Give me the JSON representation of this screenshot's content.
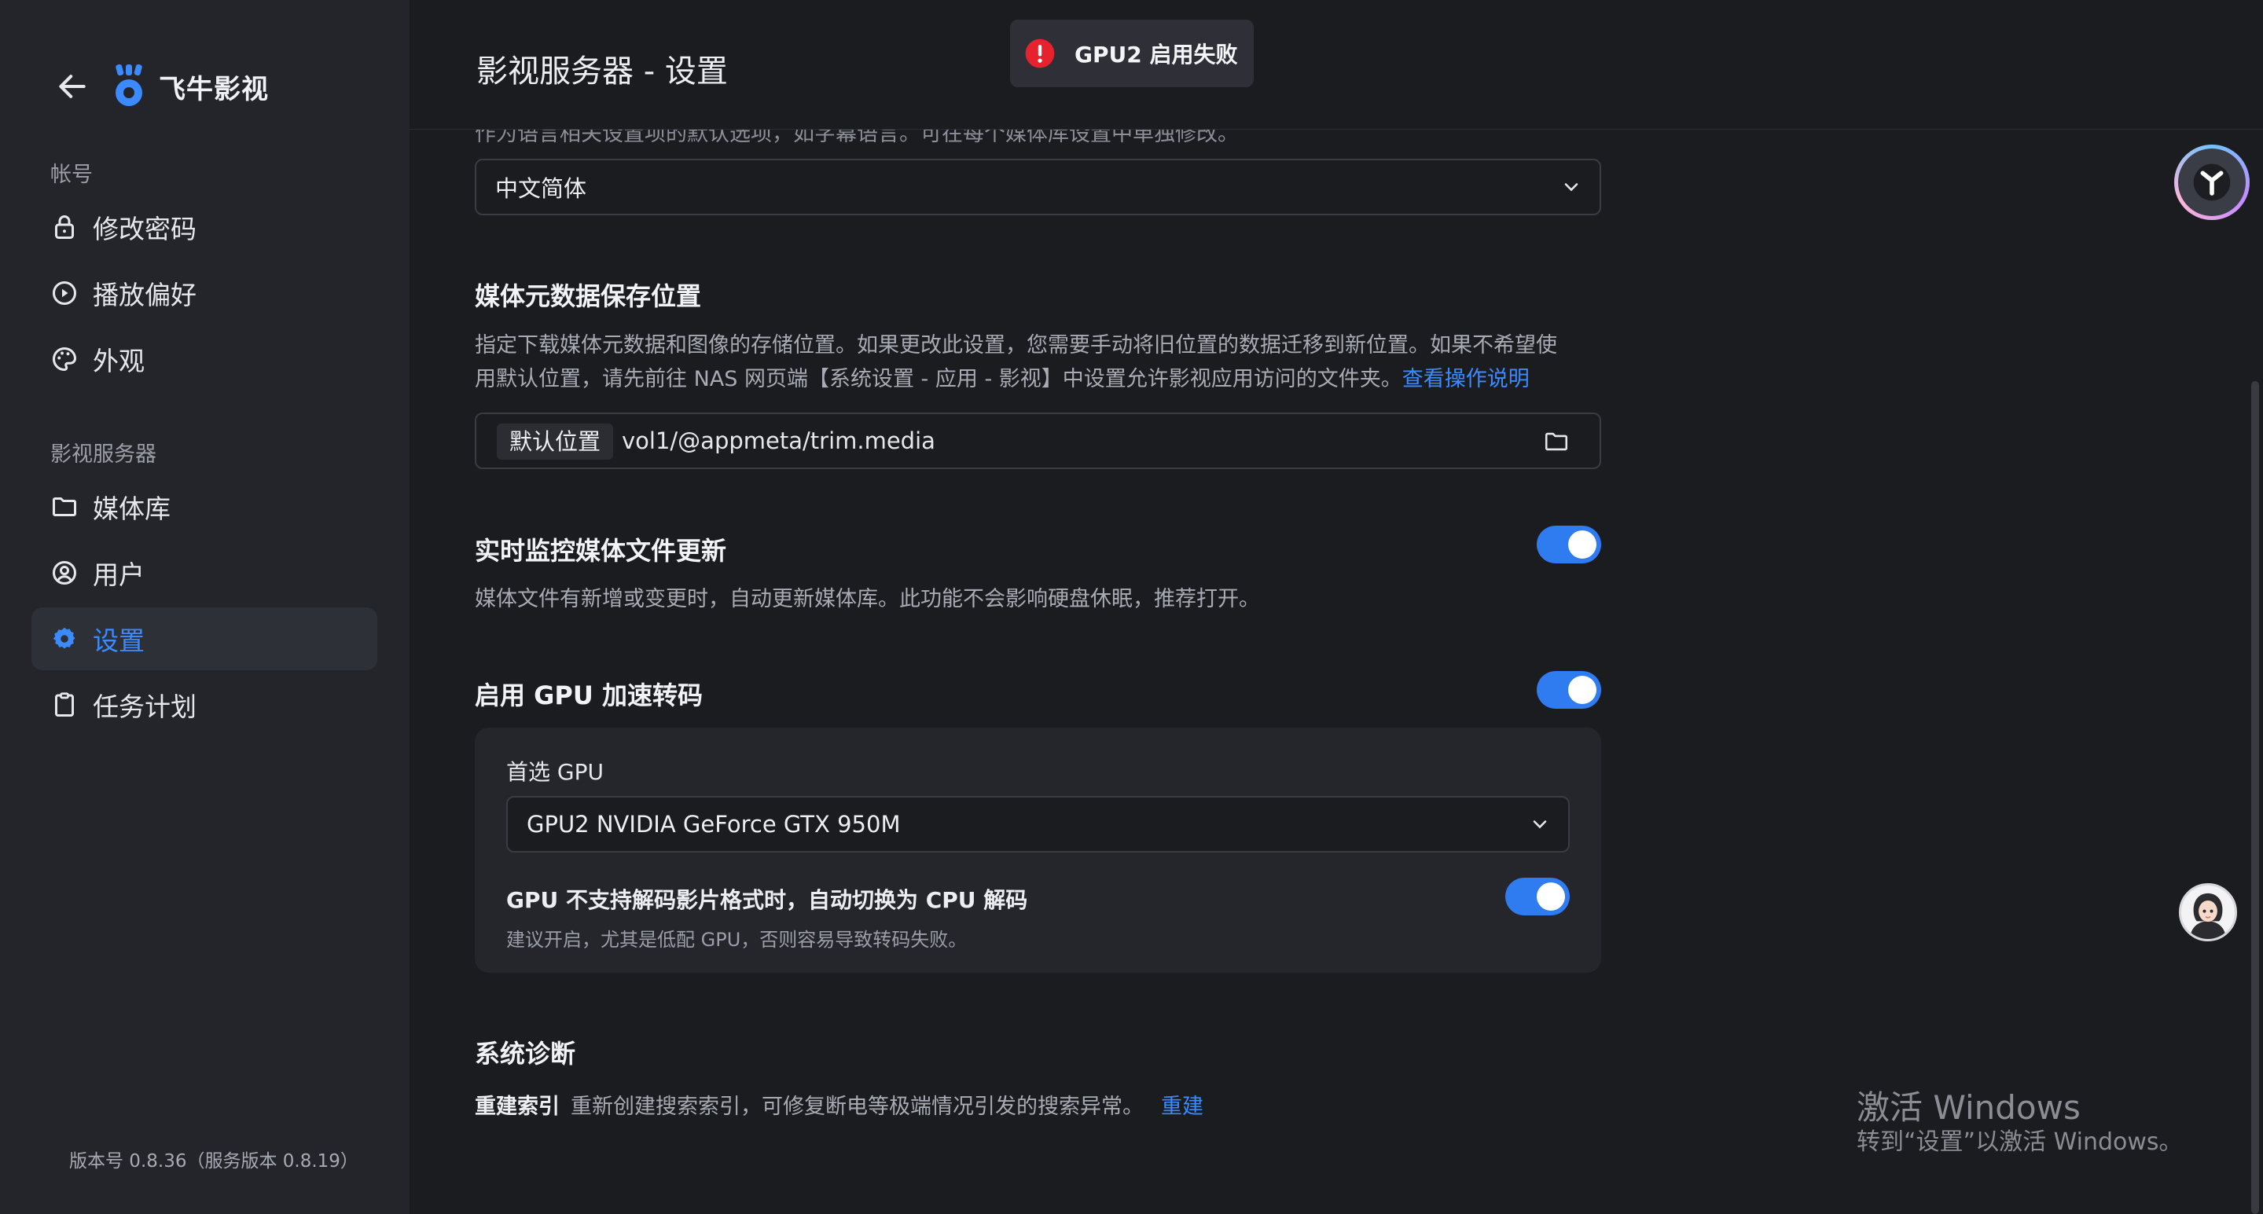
{
  "app": {
    "title": "飞牛影视",
    "version": "版本号 0.8.36（服务版本 0.8.19）"
  },
  "sidebar": {
    "account_label": "帐号",
    "account_items": [
      {
        "label": "修改密码",
        "icon": "lock-icon"
      },
      {
        "label": "播放偏好",
        "icon": "play-circle-icon"
      },
      {
        "label": "外观",
        "icon": "palette-icon"
      }
    ],
    "server_label": "影视服务器",
    "server_items": [
      {
        "label": "媒体库",
        "icon": "folder-icon"
      },
      {
        "label": "用户",
        "icon": "user-circle-icon"
      },
      {
        "label": "设置",
        "icon": "gear-icon",
        "active": true
      },
      {
        "label": "任务计划",
        "icon": "clipboard-icon"
      }
    ]
  },
  "header": {
    "title": "影视服务器 - 设置"
  },
  "toast": {
    "message": "GPU2 启用失败",
    "icon": "error-icon",
    "color": "#e5222d"
  },
  "language": {
    "cutoff_description": "作为语言相关设置项的默认选项，如字幕语言。可在每个媒体库设置中单独修改。",
    "selected": "中文简体"
  },
  "metadata": {
    "title": "媒体元数据保存位置",
    "description_line1": "指定下载媒体元数据和图像的存储位置。如果更改此设置，您需要手动将旧位置的数据迁移到新位置。如果不希望使",
    "description_line2": "用默认位置，请先前往 NAS 网页端【系统设置 - 应用 - 影视】中设置允许影视应用访问的文件夹。",
    "help_link": "查看操作说明",
    "path_tag": "默认位置",
    "path_value": "vol1/@appmeta/trim.media"
  },
  "monitor": {
    "title": "实时监控媒体文件更新",
    "description": "媒体文件有新增或变更时，自动更新媒体库。此功能不会影响硬盘休眠，推荐打开。",
    "enabled": true
  },
  "gpu": {
    "title": "启用 GPU 加速转码",
    "enabled": true,
    "preferred_label": "首选 GPU",
    "preferred_value": "GPU2 NVIDIA GeForce GTX 950M",
    "fallback_title": "GPU 不支持解码影片格式时，自动切换为 CPU 解码",
    "fallback_desc": "建议开启，尤其是低配 GPU，否则容易导致转码失败。",
    "fallback_enabled": true
  },
  "diagnostics": {
    "title": "系统诊断",
    "rebuild_label": "重建索引",
    "rebuild_desc": "重新创建搜索索引，可修复断电等极端情况引发的搜索异常。",
    "rebuild_link": "重建"
  },
  "watermark": {
    "line1": "激活 Windows",
    "line2": "转到“设置”以激活 Windows。"
  },
  "colors": {
    "accent": "#3b8bff",
    "toggle_on": "#2f7bf0",
    "background": "#1b1c20",
    "sidebar": "#24252b"
  }
}
